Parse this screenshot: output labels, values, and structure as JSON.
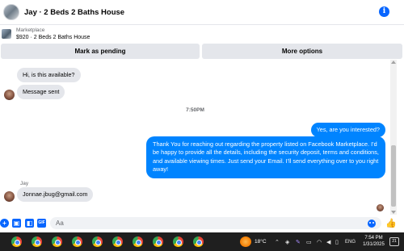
{
  "header": {
    "title": "Jay · 2 Beds 2 Baths House",
    "info_icon": "info-icon"
  },
  "marketplace": {
    "label": "Marketplace",
    "item": "$920 · 2 Beds 2 Baths House"
  },
  "actions": {
    "pending": "Mark as pending",
    "more": "More options"
  },
  "messages": {
    "m1": "Hi, is this available?",
    "m2": "Message sent",
    "timestamp": "7:50PM",
    "m3": "Yes, are you interested?",
    "m4": "Thank You for reaching out regarding the property listed on Facebook Marketplace. I'd be happy to provide all the details, including the security deposit, terms and conditions, and available viewing times. Just send your Email. I'll send everything over to you right away!",
    "sender": "Jay",
    "m5": "Jonnae.jbug@gmail.com"
  },
  "composer": {
    "placeholder": "Aa"
  },
  "taskbar": {
    "temperature": "18°C",
    "language": "ENG",
    "time": "7:54 PM",
    "date": "1/31/2025",
    "notifications": "21"
  },
  "colors": {
    "accent": "#0866ff",
    "outgoing_bubble": "#0084ff",
    "incoming_bubble": "#e4e6eb"
  }
}
